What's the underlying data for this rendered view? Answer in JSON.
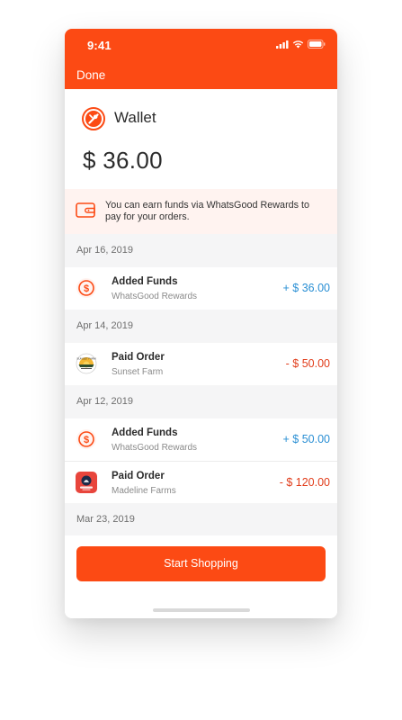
{
  "status_bar": {
    "time": "9:41"
  },
  "header": {
    "done_label": "Done"
  },
  "wallet": {
    "title": "Wallet",
    "balance": "$ 36.00"
  },
  "notice": {
    "text": "You can earn funds via WhatsGood Rewards to pay for your orders."
  },
  "groups": [
    {
      "date": "Apr 16, 2019",
      "transactions": [
        {
          "name": "Added Funds",
          "source": "WhatsGood Rewards",
          "amount": "+ $ 36.00",
          "icon": "dollar-coin-icon"
        }
      ]
    },
    {
      "date": "Apr 14, 2019",
      "transactions": [
        {
          "name": "Paid Order",
          "source": "Sunset Farm",
          "amount": "- $ 50.00",
          "icon": "sunset-farm-logo"
        }
      ]
    },
    {
      "date": "Apr 12, 2019",
      "transactions": [
        {
          "name": "Added Funds",
          "source": "WhatsGood Rewards",
          "amount": "+ $ 50.00",
          "icon": "dollar-coin-icon"
        },
        {
          "name": "Paid Order",
          "source": "Madeline Farms",
          "amount": "- $ 120.00",
          "icon": "madeline-farms-logo"
        }
      ]
    },
    {
      "date": "Mar 23, 2019",
      "transactions": []
    }
  ],
  "footer": {
    "cta_label": "Start Shopping"
  },
  "colors": {
    "brand": "#fc4a14",
    "positive": "#2a8fd4",
    "negative": "#e13c1a",
    "section_bg": "#f5f5f6"
  }
}
